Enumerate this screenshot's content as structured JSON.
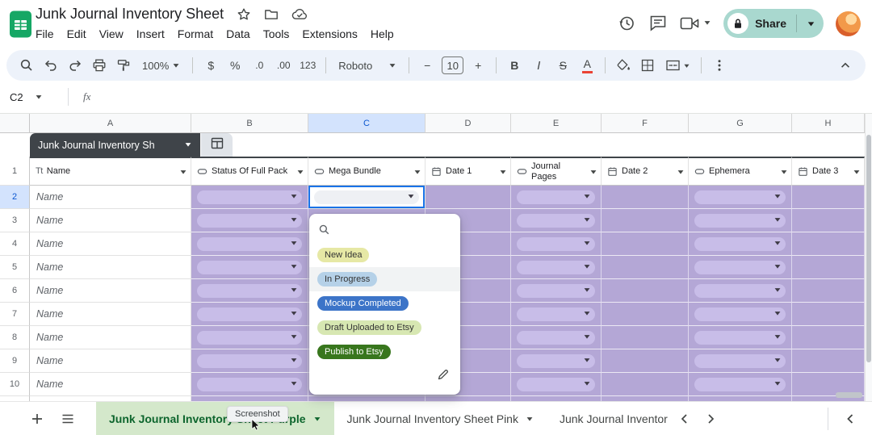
{
  "titlebar": {
    "title": "Junk Journal Inventory Sheet",
    "menus": [
      "File",
      "Edit",
      "View",
      "Insert",
      "Format",
      "Data",
      "Tools",
      "Extensions",
      "Help"
    ],
    "share_label": "Share",
    "share_button_color": "#a9d8cf"
  },
  "toolbar": {
    "zoom_value": "100%",
    "currency_label": "$",
    "percent_label": "%",
    "decimal_decrease_label": ".0",
    "decimal_increase_label": ".00",
    "number_format_label": "123",
    "font_name": "Roboto",
    "minus_label": "−",
    "font_size_value": "10",
    "plus_label": "+",
    "bold_label": "B",
    "italic_label": "I",
    "strikethrough_label": "S",
    "text_color_label": "A"
  },
  "formula_bar": {
    "cell_reference": "C2",
    "fx_label": "fx"
  },
  "grid": {
    "column_letters": [
      "A",
      "B",
      "C",
      "D",
      "E",
      "F",
      "G",
      "H"
    ],
    "selected_column": "C",
    "selected_row": "2",
    "selected_cell": "C2",
    "table_name_chip": "Junk Journal Inventory Sh",
    "header_row": [
      {
        "label": "Name",
        "icon": "text-format-icon"
      },
      {
        "label": "Status Of Full Pack",
        "icon": "dropdown-chip-icon"
      },
      {
        "label": "Mega Bundle",
        "icon": "dropdown-chip-icon"
      },
      {
        "label": "Date 1",
        "icon": "calendar-icon"
      },
      {
        "label": "Journal Pages",
        "icon": "dropdown-chip-icon"
      },
      {
        "label": "Date 2",
        "icon": "calendar-icon"
      },
      {
        "label": "Ephemera",
        "icon": "dropdown-chip-icon"
      },
      {
        "label": "Date 3",
        "icon": "calendar-icon"
      }
    ],
    "column_types": [
      "text",
      "chip",
      "chip",
      "date",
      "chip",
      "date",
      "chip",
      "date"
    ],
    "row_numbers": [
      "1",
      "2",
      "3",
      "4",
      "5",
      "6",
      "7",
      "8",
      "9",
      "10"
    ],
    "name_cell_text": "Name",
    "colors": {
      "cell_fill_purple": "#b4a7d6",
      "chip_fill_purple": "#c8bde8",
      "header_highlight": "#d3e3fd",
      "selection_blue": "#1a73e8"
    }
  },
  "status_dropdown": {
    "options": [
      {
        "label": "New Idea",
        "bg": "#e6e8a5",
        "fg": "#333333",
        "highlighted": false
      },
      {
        "label": "In Progress",
        "bg": "#b5d1e8",
        "fg": "#333333",
        "highlighted": true
      },
      {
        "label": "Mockup Completed",
        "bg": "#3c74c8",
        "fg": "#ffffff",
        "highlighted": false
      },
      {
        "label": "Draft Uploaded to Etsy",
        "bg": "#d7e7b2",
        "fg": "#333333",
        "highlighted": false
      },
      {
        "label": "Publish to Etsy",
        "bg": "#38761d",
        "fg": "#ffffff",
        "highlighted": false
      }
    ]
  },
  "sheet_tabs": {
    "active_tab": "Junk Journal Inventory Sheet Purple",
    "active_bg": "#d4e8cb",
    "active_color": "#0d652d",
    "tabs": [
      "Junk Journal Inventory Sheet Pink",
      "Junk Journal Inventor"
    ],
    "screenshot_badge": "Screenshot"
  }
}
